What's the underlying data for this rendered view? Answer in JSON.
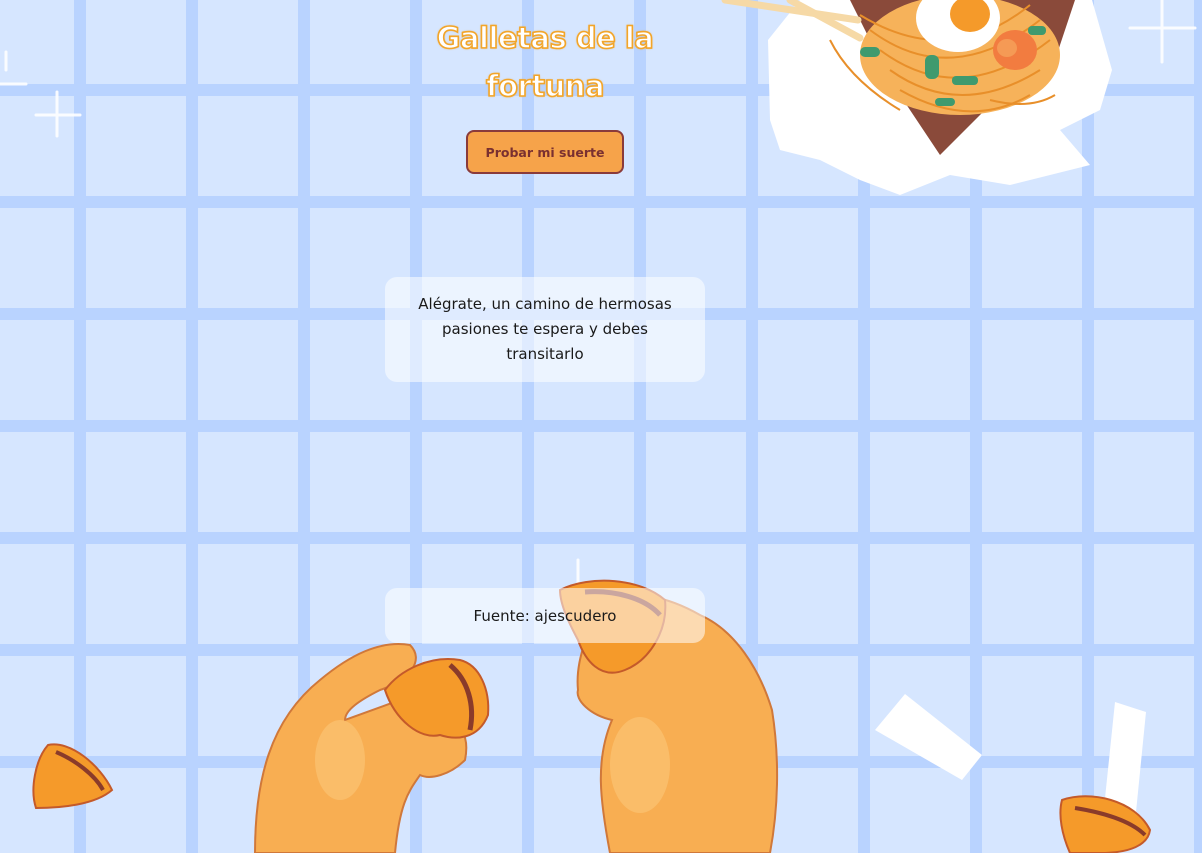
{
  "page": {
    "title": "Galletas de la fortuna",
    "button_label": "Probar mi suerte",
    "fortune_message": "Alégrate, un camino de hermosas pasiones te espera y debes transitarlo",
    "source_text": "Fuente: ajescudero"
  },
  "theme": {
    "background": "#d6e6ff",
    "grid_line": "#b9d3ff",
    "accent_orange": "#f6a34a",
    "button_border": "#8a3b3b",
    "title_outline": "#f2a52a"
  },
  "decorations": {
    "noodle_box": "noodle-box-illustration",
    "hands": "hands-breaking-fortune-cookie-illustration",
    "cookies": "fortune-cookie-icon",
    "paper": "fortune-paper-slip-icon",
    "sparkles": "sparkle-icon"
  }
}
